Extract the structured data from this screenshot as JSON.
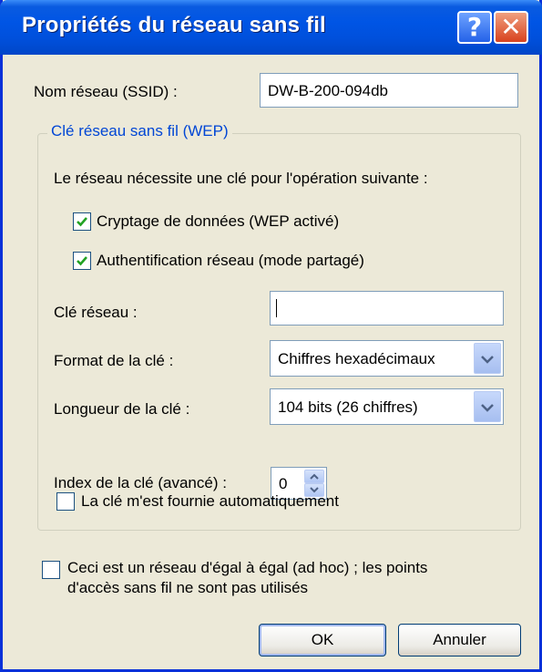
{
  "window": {
    "title": "Propriétés du réseau sans fil",
    "help_glyph": "?",
    "close_glyph": "✕"
  },
  "ssid": {
    "label": "Nom réseau (SSID) :",
    "value": "DW-B-200-094db"
  },
  "wep_group": {
    "legend": "Clé réseau sans fil (WEP)",
    "description": "Le réseau nécessite une clé pour l'opération suivante :",
    "encryption": {
      "label": "Cryptage de données (WEP activé)",
      "checked": true
    },
    "authentication": {
      "label": "Authentification réseau (mode partagé)",
      "checked": true
    },
    "network_key": {
      "label": "Clé réseau :",
      "value": ""
    },
    "key_format": {
      "label": "Format de la clé :",
      "value": "Chiffres hexadécimaux"
    },
    "key_length": {
      "label": "Longueur de la clé :",
      "value": "104 bits (26 chiffres)"
    },
    "key_index": {
      "label": "Index de la clé (avancé) :",
      "value": "0"
    },
    "auto_key": {
      "label": "La clé m'est fournie automatiquement",
      "checked": false
    }
  },
  "adhoc": {
    "label_line1": "Ceci est un réseau d'égal à égal (ad hoc) ; les points",
    "label_line2": "d'accès sans fil ne sont pas utilisés",
    "checked": false
  },
  "buttons": {
    "ok": "OK",
    "cancel": "Annuler"
  },
  "colors": {
    "titlebar": "#0055E5",
    "face": "#ECE9D8",
    "legend": "#0046D5",
    "check": "#21A121"
  }
}
